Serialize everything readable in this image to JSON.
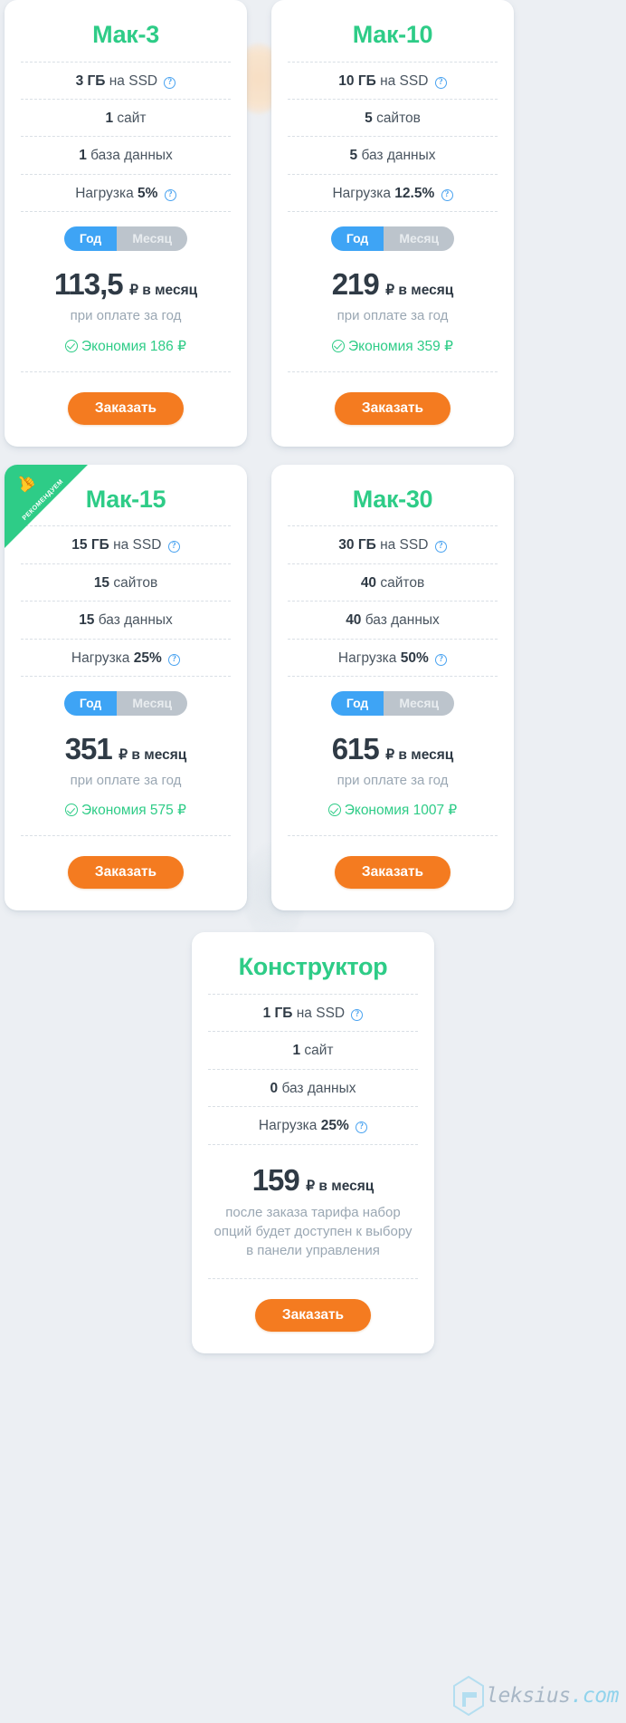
{
  "page": {
    "background_color": "#eceff3",
    "accent_green": "#2ecc87",
    "accent_orange": "#f47b20",
    "accent_blue": "#3ea4f5"
  },
  "common": {
    "order_label": "Заказать",
    "toggle_year": "Год",
    "toggle_month": "Месяц",
    "price_unit": "₽ в месяц",
    "price_note": "при оплате за год",
    "help_icon": "question-mark-icon",
    "check_icon": "check-circle-icon",
    "ribbon_label": "РЕКОМЕНДУЕМ",
    "ribbon_icon": "thumbs-up-icon"
  },
  "plans": [
    {
      "title": "Мак-3",
      "disk": "3 ГБ",
      "disk_rest": "на SSD",
      "sites_num": "1",
      "sites_rest": "сайт",
      "db_num": "1",
      "db_rest": "база данных",
      "load_label": "Нагрузка",
      "load_value": "5%",
      "price": "113,5",
      "saving": "Экономия 186 ₽",
      "recommended": false
    },
    {
      "title": "Мак-10",
      "disk": "10 ГБ",
      "disk_rest": "на SSD",
      "sites_num": "5",
      "sites_rest": "сайтов",
      "db_num": "5",
      "db_rest": "баз данных",
      "load_label": "Нагрузка",
      "load_value": "12.5%",
      "price": "219",
      "saving": "Экономия 359 ₽",
      "recommended": false
    },
    {
      "title": "Мак-15",
      "disk": "15 ГБ",
      "disk_rest": "на SSD",
      "sites_num": "15",
      "sites_rest": "сайтов",
      "db_num": "15",
      "db_rest": "баз данных",
      "load_label": "Нагрузка",
      "load_value": "25%",
      "price": "351",
      "saving": "Экономия 575 ₽",
      "recommended": true
    },
    {
      "title": "Мак-30",
      "disk": "30 ГБ",
      "disk_rest": "на SSD",
      "sites_num": "40",
      "sites_rest": "сайтов",
      "db_num": "40",
      "db_rest": "баз данных",
      "load_label": "Нагрузка",
      "load_value": "50%",
      "price": "615",
      "saving": "Экономия 1007 ₽",
      "recommended": false
    }
  ],
  "constructor": {
    "title": "Конструктор",
    "disk": "1 ГБ",
    "disk_rest": "на SSD",
    "sites_num": "1",
    "sites_rest": "сайт",
    "db_num": "0",
    "db_rest": "баз данных",
    "load_label": "Нагрузка",
    "load_value": "25%",
    "price": "159",
    "price_unit": "₽ в месяц",
    "note": "после заказа тарифа набор опций будет доступен к выбору в панели управления",
    "order_label": "Заказать"
  },
  "watermark": {
    "a": "A",
    "leks": "leksius",
    "com": ".com"
  }
}
